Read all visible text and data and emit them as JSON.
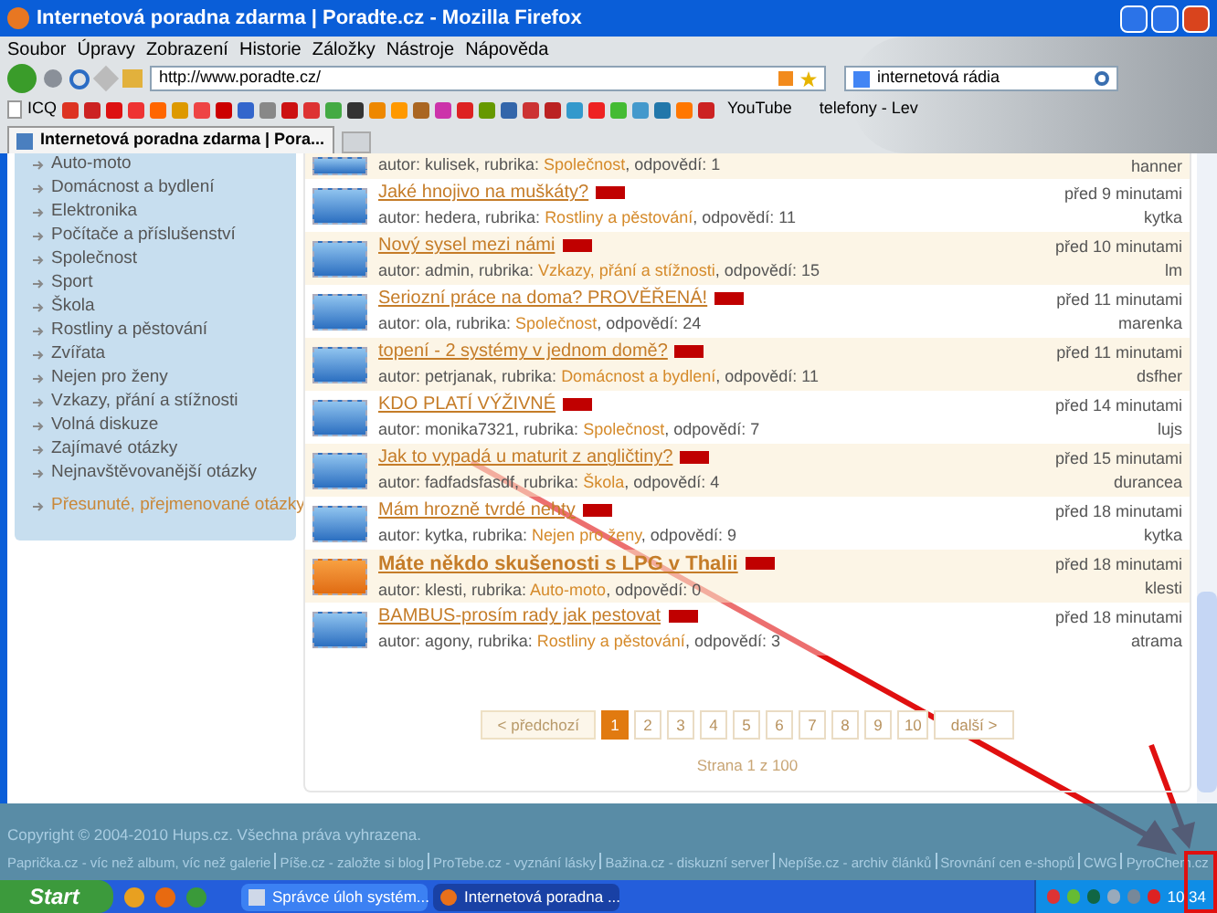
{
  "window": {
    "title": "Internetová poradna zdarma | Poradte.cz - Mozilla Firefox"
  },
  "menu": [
    "Soubor",
    "Úpravy",
    "Zobrazení",
    "Historie",
    "Záložky",
    "Nástroje",
    "Nápověda"
  ],
  "address": {
    "value": "http://www.poradte.cz/"
  },
  "search": {
    "value": "internetová rádia"
  },
  "bookmarks": [
    "ICQ",
    "YouTube",
    "telefony - Lev"
  ],
  "tab": {
    "label": "Internetová poradna zdarma | Pora...",
    "selected": true
  },
  "sidebar": {
    "items": [
      {
        "label": "Auto-moto",
        "kind": "category"
      },
      {
        "label": "Domácnost a bydlení",
        "kind": "category"
      },
      {
        "label": "Elektronika",
        "kind": "category"
      },
      {
        "label": "Počítače a příslušenství",
        "kind": "category"
      },
      {
        "label": "Společnost",
        "kind": "category"
      },
      {
        "label": "Sport",
        "kind": "category"
      },
      {
        "label": "Škola",
        "kind": "category"
      },
      {
        "label": "Rostliny a pěstování",
        "kind": "category"
      },
      {
        "label": "Zvířata",
        "kind": "category"
      },
      {
        "label": "Nejen pro ženy",
        "kind": "category"
      },
      {
        "label": "Vzkazy, přání a stížnosti",
        "kind": "category"
      },
      {
        "label": "Volná diskuze",
        "kind": "category"
      },
      {
        "label": "Zajímavé otázky",
        "kind": "category"
      },
      {
        "label": "Nejnavštěvovanější otázky",
        "kind": "category"
      },
      {
        "label": "Přesunuté, přejmenované otázky",
        "kind": "special"
      }
    ]
  },
  "questions": [
    {
      "author": "autor: kulisek, rubrika: ",
      "category": "Společnost",
      "answers": ", odpovědí: 1",
      "user": "hanner",
      "highlighted": true,
      "unread": false
    },
    {
      "title": "Jaké hnojivo na muškáty?",
      "author": "autor: hedera, rubrika: ",
      "category": "Rostliny a pěstování",
      "answers": ", odpovědí: 11",
      "time": "před 9 minutami",
      "user": "kytka",
      "highlighted": false,
      "unread": false
    },
    {
      "title": "Nový sysel mezi námi",
      "author": "autor: admin, rubrika: ",
      "category": "Vzkazy, přání a stížnosti",
      "answers": ", odpovědí: 15",
      "time": "před 10 minutami",
      "user": "lm",
      "highlighted": true,
      "unread": false
    },
    {
      "title": "Seriozní práce na doma? PROVĚŘENÁ!",
      "author": "autor: ola, rubrika: ",
      "category": "Společnost",
      "answers": ", odpovědí: 24",
      "time": "před 11 minutami",
      "user": "marenka",
      "highlighted": false,
      "unread": false
    },
    {
      "title": "topení - 2 systémy v jednom domě?",
      "author": "autor: petrjanak, rubrika: ",
      "category": "Domácnost a bydlení",
      "answers": ", odpovědí: 11",
      "time": "před 11 minutami",
      "user": "dsfher",
      "highlighted": true,
      "unread": false
    },
    {
      "title": "KDO PLATÍ VÝŽIVNÉ",
      "author": "autor: monika7321, rubrika: ",
      "category": "Společnost",
      "answers": ", odpovědí: 7",
      "time": "před 14 minutami",
      "user": "lujs",
      "highlighted": false,
      "unread": false
    },
    {
      "title": "Jak to vypadá u maturit z angličtiny?",
      "author": "autor: fadfadsfasdf, rubrika: ",
      "category": "Škola",
      "answers": ", odpovědí: 4",
      "time": "před 15 minutami",
      "user": "durancea",
      "highlighted": true,
      "unread": false
    },
    {
      "title": "Mám hrozně tvrdé nehty",
      "author": "autor: kytka, rubrika: ",
      "category": "Nejen pro ženy",
      "answers": ", odpovědí: 9",
      "time": "před 18 minutami",
      "user": "kytka",
      "highlighted": false,
      "unread": false
    },
    {
      "title": "Máte někdo skušenosti s LPG v Thalii",
      "author": "autor: klesti, rubrika: ",
      "category": "Auto-moto",
      "answers": ", odpovědí: 0",
      "time": "před 18 minutami",
      "user": "klesti",
      "highlighted": true,
      "unread": true
    },
    {
      "title": "BAMBUS-prosím rady jak pestovat",
      "author": "autor: agony, rubrika: ",
      "category": "Rostliny a pěstování",
      "answers": ", odpovědí: 3",
      "time": "před 18 minutami",
      "user": "atrama",
      "highlighted": false,
      "unread": false
    }
  ],
  "pagination": {
    "pages": [
      {
        "label": "< předchozí",
        "selected": false,
        "disabled": true
      },
      {
        "label": "1",
        "selected": true,
        "disabled": false
      },
      {
        "label": "2",
        "selected": false,
        "disabled": false
      },
      {
        "label": "3",
        "selected": false,
        "disabled": false
      },
      {
        "label": "4",
        "selected": false,
        "disabled": false
      },
      {
        "label": "5",
        "selected": false,
        "disabled": false
      },
      {
        "label": "6",
        "selected": false,
        "disabled": false
      },
      {
        "label": "7",
        "selected": false,
        "disabled": false
      },
      {
        "label": "8",
        "selected": false,
        "disabled": false
      },
      {
        "label": "9",
        "selected": false,
        "disabled": false
      },
      {
        "label": "10",
        "selected": false,
        "disabled": false
      },
      {
        "label": "další >",
        "selected": false,
        "disabled": false
      }
    ],
    "summary": "Strana 1 z 100"
  },
  "footer": {
    "copyright": "Copyright © 2004-2010 Hups.cz. Všechna práva vyhrazena.",
    "links": [
      "Paprička.cz - víc než album, víc než galerie",
      "Píše.cz - založte si blog",
      "ProTebe.cz - vyznání lásky",
      "Bažina.cz - diskuzní server",
      "Nepíše.cz - archiv článků",
      "Srovnání cen e-shopů",
      "CWG",
      "PyroChem.cz"
    ]
  },
  "taskbar": {
    "start": "Start",
    "tasks": [
      {
        "label": "Správce úloh systém...",
        "selected": false
      },
      {
        "label": "Internetová poradna ...",
        "selected": true
      }
    ],
    "clock": "10:34"
  }
}
